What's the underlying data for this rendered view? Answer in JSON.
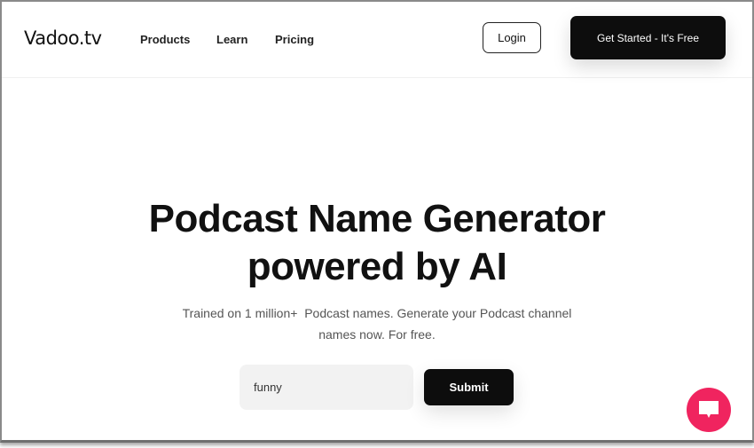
{
  "header": {
    "logo": "Vadoo.tv",
    "nav": [
      {
        "label": "Products"
      },
      {
        "label": "Learn"
      },
      {
        "label": "Pricing"
      }
    ],
    "login_label": "Login",
    "cta_label": "Get Started - It's Free"
  },
  "hero": {
    "title_line1": "Podcast Name Generator",
    "title_line2": "powered by AI",
    "subtitle_line1": "Trained on 1 million+  Podcast names. Generate your Podcast channel",
    "subtitle_line2": "names now. For free.",
    "input_value": "funny",
    "submit_label": "Submit"
  },
  "chat": {
    "icon": "chat-bubble-icon",
    "color": "#f0245f"
  }
}
